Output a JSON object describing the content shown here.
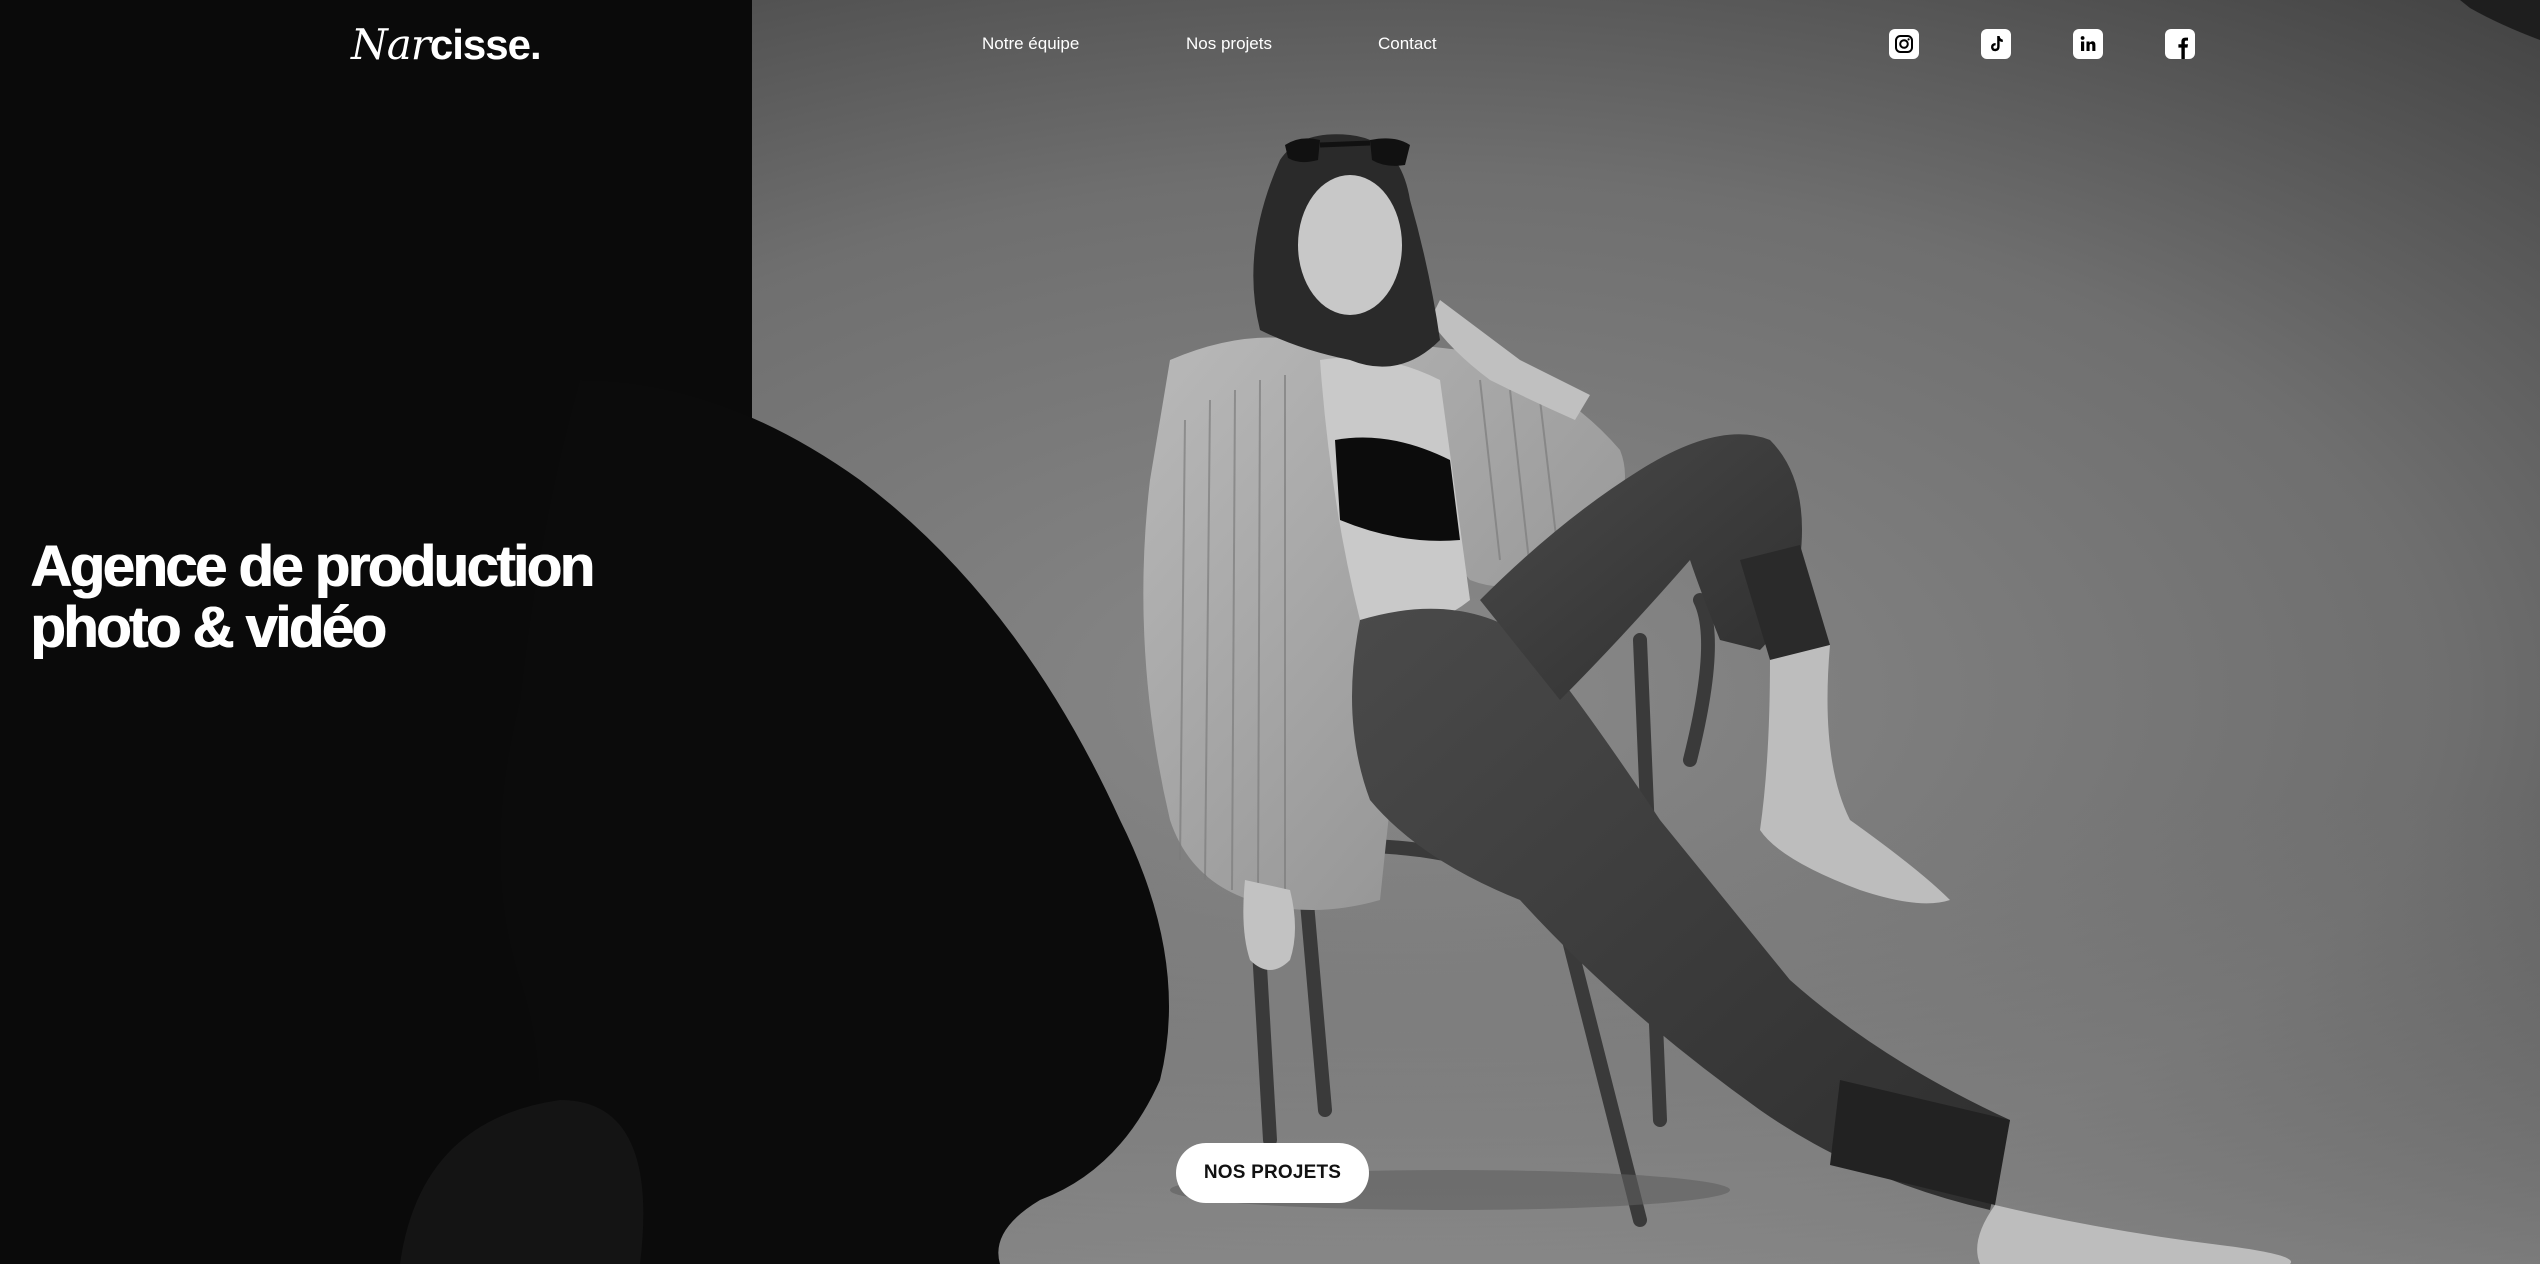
{
  "header": {
    "logo": {
      "italic": "Nar",
      "bold": "cisse."
    },
    "nav": [
      {
        "label": "Notre équipe"
      },
      {
        "label": "Nos projets"
      },
      {
        "label": "Contact"
      }
    ],
    "socials": [
      {
        "icon": "instagram-icon"
      },
      {
        "icon": "tiktok-icon"
      },
      {
        "icon": "linkedin-icon"
      },
      {
        "icon": "facebook-icon"
      }
    ]
  },
  "hero": {
    "headline": [
      "Agence de production",
      "photo & vidéo"
    ],
    "cta_label": "NOS PROJETS",
    "image": "black-and-white studio photo of a seated model in blazer and jeans"
  },
  "colors": {
    "text": "#ffffff",
    "button_bg": "#ffffff",
    "button_text": "#111111",
    "studio_backdrop": "#6e6e6e",
    "foreground_dark": "#0a0a0a"
  }
}
